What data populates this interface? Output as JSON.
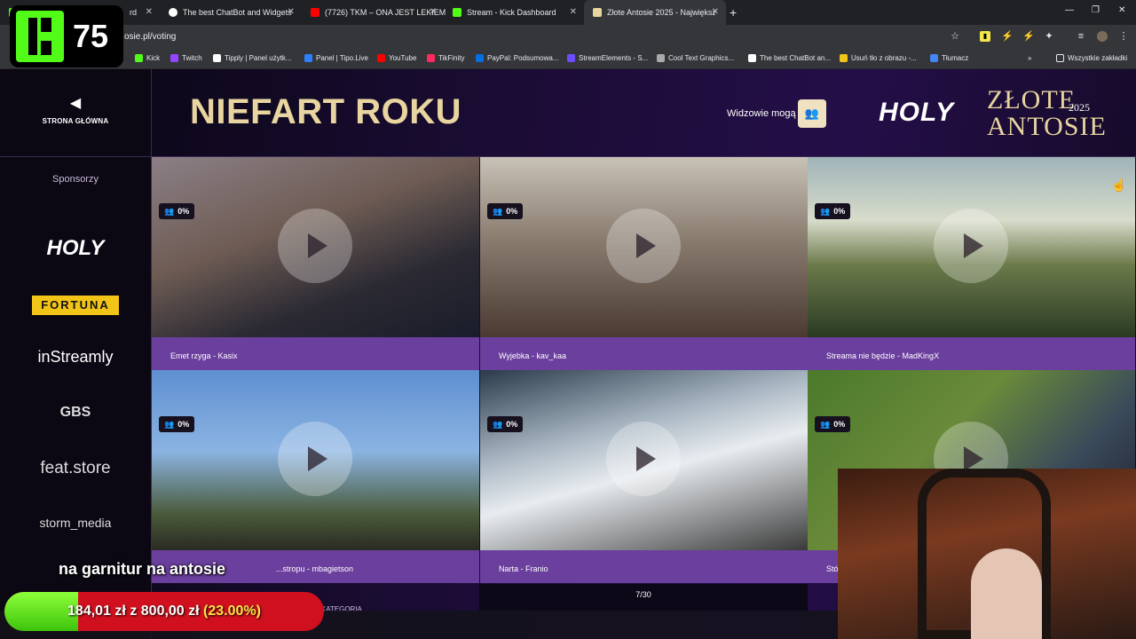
{
  "browser": {
    "tabs": [
      {
        "title": "rd",
        "favicon_color": "#53fc18"
      },
      {
        "title": "The best ChatBot and Widgets",
        "favicon_color": "#ffffff"
      },
      {
        "title": "(7726) TKM – ONA JEST LEKIEM",
        "favicon_color": "#ff0000"
      },
      {
        "title": "Stream - Kick Dashboard",
        "favicon_color": "#53fc18"
      },
      {
        "title": "Złote Antosie 2025 - Największ",
        "favicon_color": "#e8d5a0"
      }
    ],
    "new_tab": "+",
    "url": "osie.pl/voting",
    "bookmarks": [
      {
        "label": "Kick",
        "color": "#53fc18"
      },
      {
        "label": "Twitch",
        "color": "#9146ff"
      },
      {
        "label": "Tipply | Panel użytk...",
        "color": "#ffffff"
      },
      {
        "label": "Panel | Tipo.Live",
        "color": "#2f80ff"
      },
      {
        "label": "YouTube",
        "color": "#ff0000"
      },
      {
        "label": "TikFinity",
        "color": "#ff2a5e"
      },
      {
        "label": "PayPal: Podsumowa...",
        "color": "#0070e0"
      },
      {
        "label": "StreamElements - S...",
        "color": "#6c4cff"
      },
      {
        "label": "Cool Text Graphics...",
        "color": "#aaaaaa"
      },
      {
        "label": "The best ChatBot an...",
        "color": "#ffffff"
      },
      {
        "label": "Usuń tło z obrazu -...",
        "color": "#f2c418"
      },
      {
        "label": "Tłumacz",
        "color": "#4285f4"
      }
    ],
    "all_bookmarks": "Wszystkie zakładki"
  },
  "kick_overlay": {
    "count": "75"
  },
  "page": {
    "home_label": "STRONA GŁÓWNA",
    "title": "NIEFART ROKU",
    "viewers_label": "Widzowie mogą",
    "logo": {
      "brand": "HOLY",
      "line1": "ZŁOTE",
      "line2": "ANTOSIE",
      "year": "2025"
    },
    "sponsors_title": "Sponsorzy",
    "sponsors": [
      "HOLY",
      "FORTUNA",
      "inStreamly",
      "GBS",
      "feat.store",
      "storm_media"
    ],
    "cards": [
      {
        "label": "Emet rzyga - Kasix",
        "percent": "0%"
      },
      {
        "label": "Wyjebka - kav_kaa",
        "percent": "0%"
      },
      {
        "label": "Streama nie będzie - MadKingX",
        "percent": "0%"
      },
      {
        "label": "...stropu - mbagietson",
        "percent": "0%"
      },
      {
        "label": "Narta - Franio",
        "percent": "0%"
      },
      {
        "label": "Stó",
        "percent": "0%"
      }
    ],
    "pagination": "7/30",
    "prev_category": "POPRZEDNIA KATEGORIA"
  },
  "overlay": {
    "caption": "na garnitur na antosie",
    "goal": {
      "current": "184,01 zł",
      "sep": "z",
      "target": "800,00 zł",
      "percent_text": "(23.00%)",
      "fraction": 0.23
    }
  }
}
